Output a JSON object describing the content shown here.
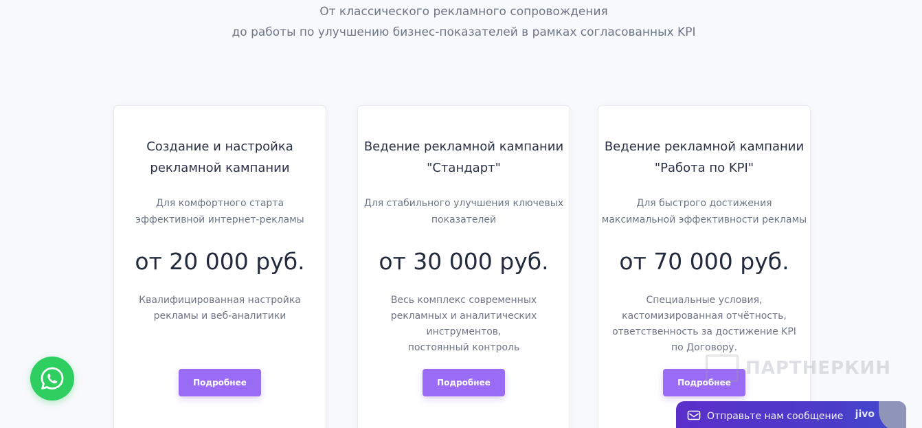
{
  "header": {
    "subtitle_line1": "От классического рекламного сопровождения",
    "subtitle_line2": "до работы по улучшению бизнес-показателей в рамках согласованных KPI"
  },
  "cards": [
    {
      "title_line1": "Создание и настройка",
      "title_line2": "рекламной кампании",
      "desc_line1": "Для комфортного старта",
      "desc_line2": "эффективной интернет-рекламы",
      "price": "от 20 000 руб.",
      "features": [
        "Квалифицированная настройка",
        "рекламы и веб-аналитики"
      ],
      "button": "Подробнее"
    },
    {
      "title_line1": "Ведение рекламной кампании",
      "title_line2": "\"Стандарт\"",
      "desc_line1": "Для стабильного улучшения ключевых",
      "desc_line2": "показателей",
      "price": "от 30 000 руб.",
      "features": [
        "Весь комплекс современных",
        "рекламных и аналитических",
        "инструментов,",
        "постоянный контроль"
      ],
      "button": "Подробнее"
    },
    {
      "title_line1": "Ведение рекламной кампании",
      "title_line2": "\"Работа по KPI\"",
      "desc_line1": "Для быстрого достижения",
      "desc_line2": "максимальной эффективности рекламы",
      "price": "от 70 000 руб.",
      "features": [
        "Специальные условия,",
        "кастомизированная отчётность,",
        "ответственность за достижение KPI",
        "по Договору."
      ],
      "button": "Подробнее"
    }
  ],
  "watermark": {
    "text": "ПАРТНЕРКИН"
  },
  "chat": {
    "label": "Отправьте нам сообщение",
    "brand": "jivo"
  },
  "colors": {
    "accent": "#9a6cf5",
    "whatsapp": "#2ecf60",
    "chat_bg": "#5a2fc9"
  },
  "icons": {
    "whatsapp": "whatsapp-icon",
    "chat": "message-icon"
  }
}
